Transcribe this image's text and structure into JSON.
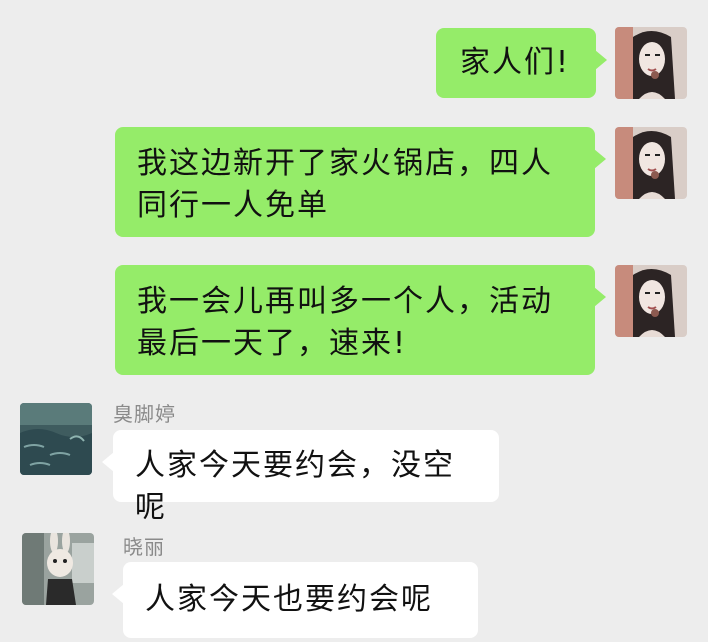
{
  "messages": [
    {
      "sender": "me",
      "avatar": "woman-portrait-avatar",
      "text": "家人们!"
    },
    {
      "sender": "me",
      "avatar": "woman-portrait-avatar",
      "text": "我这边新开了家火锅店，四人同行一人免单"
    },
    {
      "sender": "me",
      "avatar": "woman-portrait-avatar",
      "text": "我一会儿再叫多一个人，活动最后一天了，速来!"
    },
    {
      "sender": "臭脚婷",
      "avatar": "water-scene-avatar",
      "text": "人家今天要约会，没空呢"
    },
    {
      "sender": "晓丽",
      "avatar": "bunny-mask-avatar",
      "text": "人家今天也要约会呢"
    }
  ],
  "colors": {
    "outgoing_bubble": "#95ec69",
    "incoming_bubble": "#ffffff",
    "background": "#ededed",
    "name_text": "#8a8a8a"
  }
}
